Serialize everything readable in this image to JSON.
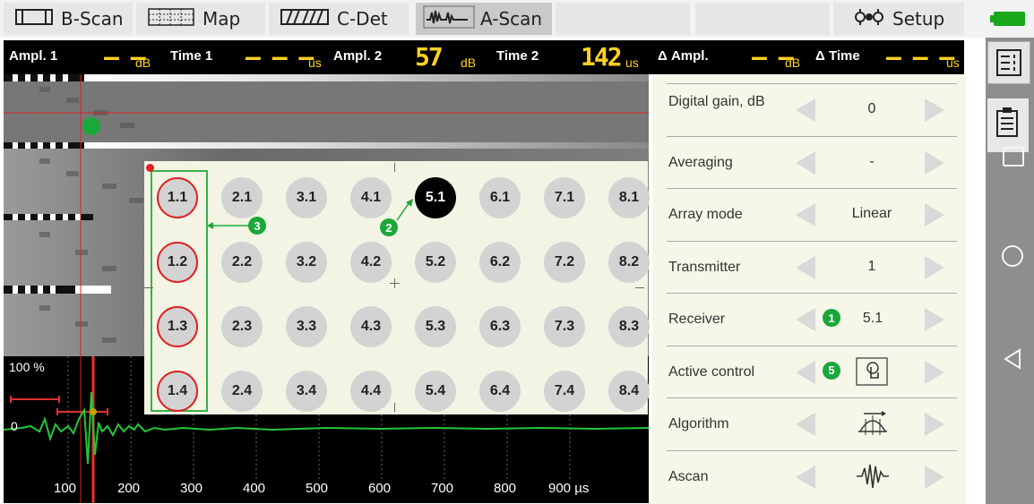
{
  "tabs": [
    {
      "label": "B-Scan",
      "icon": "bscan-icon"
    },
    {
      "label": "Map",
      "icon": "map-grid-icon"
    },
    {
      "label": "C-Det",
      "icon": "cdet-icon"
    },
    {
      "label": "A-Scan",
      "icon": "ascan-icon",
      "active": true
    },
    {
      "label": "Setup",
      "icon": "gears-icon"
    }
  ],
  "measurements": {
    "ampl1": {
      "label": "Ampl. 1",
      "value": "– –",
      "unit": "dB"
    },
    "time1": {
      "label": "Time 1",
      "value": "– – –",
      "unit": "us"
    },
    "ampl2": {
      "label": "Ampl. 2",
      "value": "57",
      "unit": "dB"
    },
    "time2": {
      "label": "Time 2",
      "value": "142",
      "unit": "us"
    },
    "dampl": {
      "label": "Δ Ampl.",
      "value": "– –",
      "unit": "dB"
    },
    "dtime": {
      "label": "Δ Time",
      "value": "– – –",
      "unit": "us"
    }
  },
  "ascan": {
    "percent_label": "100 %",
    "zero_label": "0",
    "axis_ticks": [
      "100",
      "200",
      "300",
      "400",
      "500",
      "600",
      "700",
      "800",
      "900 µs"
    ]
  },
  "element_grid": {
    "columns": [
      [
        "1.1",
        "1.2",
        "1.3",
        "1.4"
      ],
      [
        "2.1",
        "2.2",
        "2.3",
        "2.4"
      ],
      [
        "3.1",
        "3.2",
        "3.3",
        "3.4"
      ],
      [
        "4.1",
        "4.2",
        "4.3",
        "4.4"
      ],
      [
        "5.1",
        "5.2",
        "5.3",
        "5.4"
      ],
      [
        "6.1",
        "6.2",
        "6.3",
        "6.4"
      ],
      [
        "7.1",
        "7.2",
        "7.3",
        "7.4"
      ],
      [
        "8.1",
        "8.2",
        "8.3",
        "8.4"
      ]
    ],
    "active_element": "5.1",
    "selected_column": 1,
    "callouts": [
      "1",
      "2",
      "3",
      "5"
    ]
  },
  "settings": [
    {
      "label": "Digital gain, dB",
      "value": "0"
    },
    {
      "label": "Averaging",
      "value": "-"
    },
    {
      "label": "Array mode",
      "value": "Linear"
    },
    {
      "label": "Transmitter",
      "value": "1"
    },
    {
      "label": "Receiver",
      "value": "5.1",
      "callout": "1"
    },
    {
      "label": "Active control",
      "value": "",
      "icon": "touch-ascan-icon",
      "callout": "5"
    },
    {
      "label": "Algorithm",
      "value": "",
      "icon": "algorithm-icon"
    },
    {
      "label": "Ascan",
      "value": "",
      "icon": "waveform-icon"
    }
  ],
  "colors": {
    "accent_yellow": "#ffd21f",
    "callout_green": "#1aa83a",
    "selection_red": "#d22222",
    "signal_green": "#22c83a"
  }
}
